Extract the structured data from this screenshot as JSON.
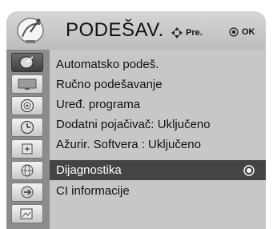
{
  "header": {
    "title": "PODEŠAV.",
    "nav_hint": "Pre.",
    "ok_hint": "OK"
  },
  "sidebar": {
    "items": [
      {
        "icon": "satellite-icon",
        "active": true
      },
      {
        "icon": "tv-screen-icon",
        "active": false
      },
      {
        "icon": "speaker-icon",
        "active": false
      },
      {
        "icon": "clock-icon",
        "active": false
      },
      {
        "icon": "lock-icon",
        "active": false
      },
      {
        "icon": "globe-icon",
        "active": false
      },
      {
        "icon": "input-icon",
        "active": false
      },
      {
        "icon": "usb-photo-icon",
        "active": false
      }
    ]
  },
  "menu": {
    "items": [
      {
        "label": "Automatsko podeš."
      },
      {
        "label": "Ručno podešavanje"
      },
      {
        "label": "Uređ. programa"
      },
      {
        "label": "Dodatni pojačivač: Uključeno"
      },
      {
        "label": "Ažurir. Softvera  : Uključeno"
      },
      {
        "label": "Dijagnostika",
        "selected": true
      },
      {
        "label": "CI informacije"
      }
    ]
  }
}
